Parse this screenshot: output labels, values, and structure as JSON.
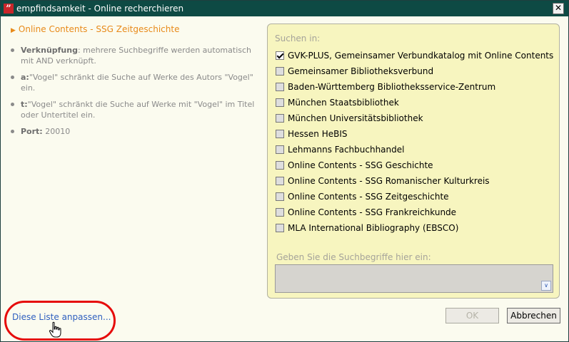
{
  "window": {
    "title": "empfindsamkeit - Online recherchieren",
    "app_icon_glyph": "”",
    "close_glyph": "✕"
  },
  "info": {
    "heading": "Online Contents - SSG Zeitgeschichte",
    "arrow_glyph": "▶",
    "tips": [
      {
        "strong": "Verknüpfung",
        "text": ": mehrere Suchbegriffe werden automatisch mit AND verknüpft."
      },
      {
        "strong": "a:",
        "text": "\"Vogel\" schränkt die Suche auf Werke des Autors \"Vogel\" ein."
      },
      {
        "strong": "t:",
        "text": "\"Vogel\" schränkt die Suche auf Werke mit \"Vogel\" im Titel oder Untertitel ein."
      },
      {
        "strong": "Port:",
        "text": " 20010"
      }
    ]
  },
  "search_panel": {
    "label": "Suchen in:",
    "catalogs": [
      {
        "label": "GVK-PLUS, Gemeinsamer Verbundkatalog mit Online Contents",
        "checked": true
      },
      {
        "label": "Gemeinsamer Bibliotheksverbund",
        "checked": false
      },
      {
        "label": "Baden-Württemberg Bibliotheksservice-Zentrum",
        "checked": false
      },
      {
        "label": "München Staatsbibliothek",
        "checked": false
      },
      {
        "label": "München Universitätsbibliothek",
        "checked": false
      },
      {
        "label": "Hessen HeBIS",
        "checked": false
      },
      {
        "label": "Lehmanns Fachbuchhandel",
        "checked": false
      },
      {
        "label": "Online Contents - SSG Geschichte",
        "checked": false
      },
      {
        "label": "Online Contents - SSG Romanischer Kulturkreis",
        "checked": false
      },
      {
        "label": "Online Contents - SSG Zeitgeschichte",
        "checked": false
      },
      {
        "label": "Online Contents - SSG Frankreichkunde",
        "checked": false
      },
      {
        "label": "MLA International Bibliography (EBSCO)",
        "checked": false
      }
    ],
    "input_label": "Geben Sie die Suchbegriffe hier ein:",
    "input_value": "",
    "dropdown_glyph": "∨"
  },
  "buttons": {
    "ok": "OK",
    "ok_enabled": false,
    "cancel": "Abbrechen"
  },
  "customize_link": "Diese Liste anpassen...",
  "colors": {
    "titlebar": "#0e4a44",
    "panel": "#f7f5bf",
    "accent": "#e88a1a",
    "link": "#2f5fbf",
    "highlight": "#e60b0b"
  }
}
